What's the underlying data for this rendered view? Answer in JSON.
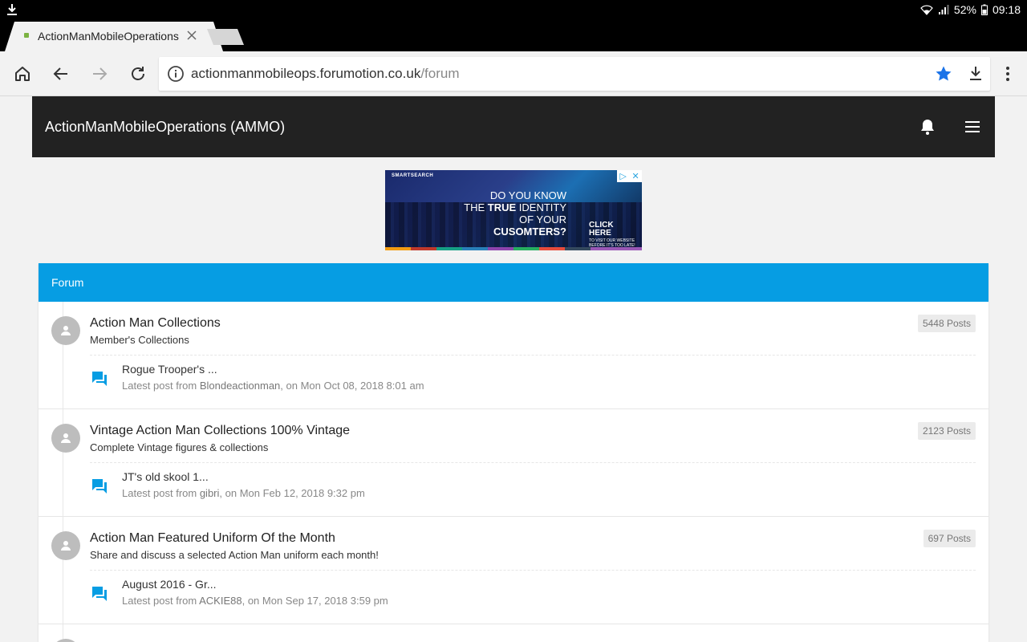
{
  "status": {
    "battery": "52%",
    "time": "09:18"
  },
  "browser": {
    "tab_title": "ActionManMobileOperations",
    "url_domain": "actionmanmobileops.forumotion.co.uk",
    "url_path": "/forum"
  },
  "site": {
    "title": "ActionManMobileOperations (AMMO)"
  },
  "ad": {
    "brand": "SMARTSEARCH",
    "line1": "DO YOU KNOW",
    "line2a": "THE ",
    "line2b": "TRUE",
    "line2c": " IDENTITY",
    "line3": "OF YOUR",
    "line4": "CUSOMTERS?",
    "cta": "CLICK HERE",
    "cta_small": "TO VISIT OUR WEBSITE BEFORE IT'S TOO LATE!"
  },
  "forum": {
    "heading": "Forum",
    "rows": [
      {
        "title": "Action Man Collections",
        "description": "Member's Collections",
        "posts": "5448 Posts",
        "last_post_title": "Rogue Trooper's ...",
        "last_post_prefix": "Latest post from ",
        "last_post_user": "Blondeactionman",
        "last_post_date": ", on Mon Oct 08, 2018 8:01 am"
      },
      {
        "title": "Vintage Action Man Collections 100% Vintage",
        "description": "Complete Vintage figures & collections",
        "posts": "2123 Posts",
        "last_post_title": "JT's old skool 1...",
        "last_post_prefix": "Latest post from ",
        "last_post_user": "gibri",
        "last_post_date": ", on Mon Feb 12, 2018 9:32 pm"
      },
      {
        "title": "Action Man Featured Uniform Of the Month",
        "description": "Share and discuss a selected Action Man uniform each month!",
        "posts": "697 Posts",
        "last_post_title": "August 2016 - Gr...",
        "last_post_prefix": "Latest post from ",
        "last_post_user": "ACKIE88",
        "last_post_date": ", on Mon Sep 17, 2018 3:59 pm"
      }
    ]
  },
  "colors": {
    "accent": "#069de3",
    "header_bg": "#222222",
    "star": "#1a73e8"
  }
}
